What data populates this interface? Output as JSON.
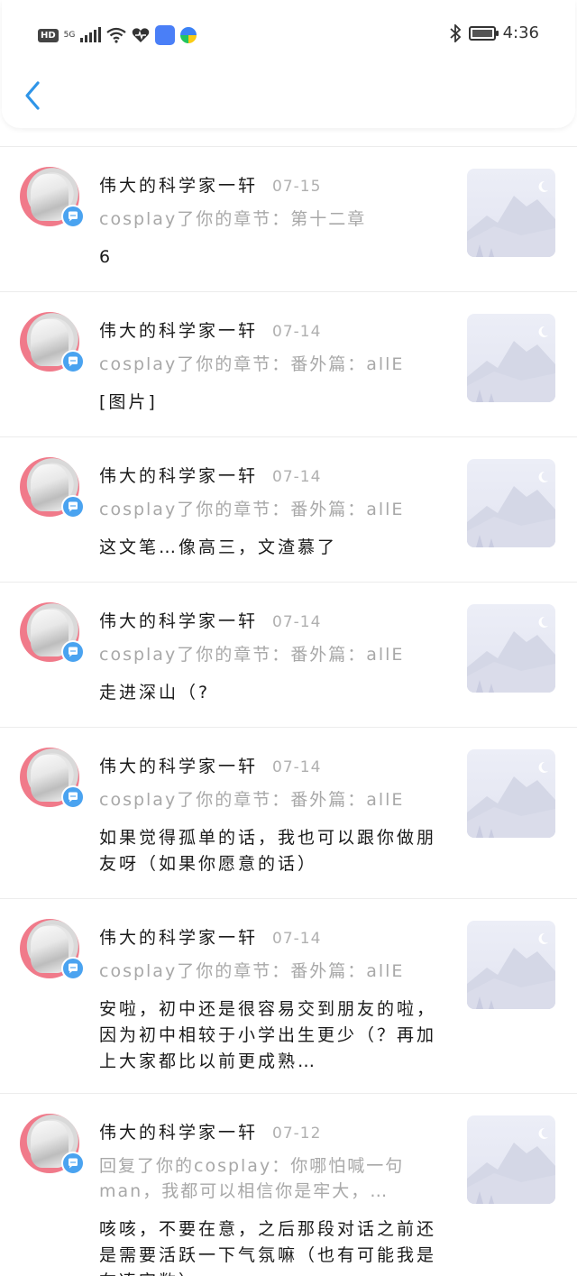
{
  "status_bar": {
    "hd": "HD",
    "network": "5G",
    "time": "4:36",
    "icons": [
      "signal-icon",
      "wifi-icon",
      "heart-icon",
      "app-icon",
      "app-icon-multicolor",
      "bluetooth-icon",
      "battery-icon"
    ]
  },
  "header": {
    "back_icon": "chevron-left-icon"
  },
  "notifications": [
    {
      "name": "伟大的科学家一轩",
      "date": "07-15",
      "sub": "cosplay了你的章节：第十二章",
      "msg": "6"
    },
    {
      "name": "伟大的科学家一轩",
      "date": "07-14",
      "sub": "cosplay了你的章节：番外篇：allE",
      "msg": "[图片]"
    },
    {
      "name": "伟大的科学家一轩",
      "date": "07-14",
      "sub": "cosplay了你的章节：番外篇：allE",
      "msg": "这文笔…像高三，文渣慕了"
    },
    {
      "name": "伟大的科学家一轩",
      "date": "07-14",
      "sub": "cosplay了你的章节：番外篇：allE",
      "msg": "走进深山（?"
    },
    {
      "name": "伟大的科学家一轩",
      "date": "07-14",
      "sub": "cosplay了你的章节：番外篇：allE",
      "msg": "如果觉得孤单的话，我也可以跟你做朋友呀（如果你愿意的话）"
    },
    {
      "name": "伟大的科学家一轩",
      "date": "07-14",
      "sub": "cosplay了你的章节：番外篇：allE",
      "msg": "安啦，初中还是很容易交到朋友的啦，因为初中相较于小学出生更少（？再加上大家都比以前更成熟…"
    },
    {
      "name": "伟大的科学家一轩",
      "date": "07-12",
      "sub": "回复了你的cosplay：你哪怕喊一句man，我都可以相信你是牢大，…",
      "msg": "咳咳，不要在意，之后那段对话之前还是需要活跃一下气氛嘛（也有可能我是在凑字数）"
    }
  ],
  "colors": {
    "accent": "#2f95e8",
    "badge": "#4aa3f0",
    "avatar_ring": "#f07a8a"
  }
}
